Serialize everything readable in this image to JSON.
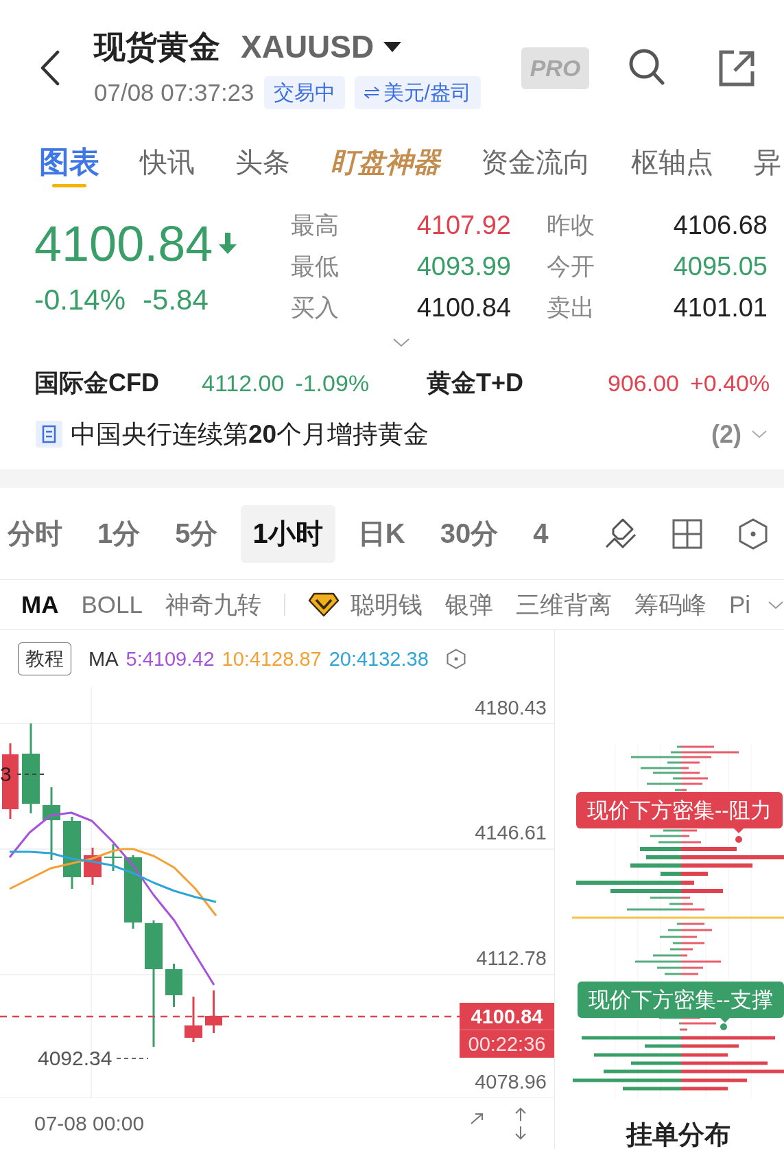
{
  "header": {
    "title": "现货黄金",
    "symbol": "XAUUSD",
    "time": "07/08 07:37:23",
    "badges": [
      {
        "kind": "status",
        "label": "交易中"
      },
      {
        "kind": "currency",
        "label": "美元/盎司"
      }
    ],
    "pro": "PRO"
  },
  "tabs": [
    {
      "label": "图表",
      "selected": true,
      "kind": "normal"
    },
    {
      "label": "快讯",
      "selected": false,
      "kind": "normal"
    },
    {
      "label": "头条",
      "selected": false,
      "kind": "normal"
    },
    {
      "label": "盯盘神器",
      "selected": false,
      "kind": "promo"
    },
    {
      "label": "资金流向",
      "selected": false,
      "kind": "normal"
    },
    {
      "label": "枢轴点",
      "selected": false,
      "kind": "normal"
    },
    {
      "label": "异",
      "selected": false,
      "kind": "normal"
    }
  ],
  "quote": {
    "price": "4100.84",
    "falling": true,
    "change_percent": "-0.14%",
    "change": "-5.84",
    "stats": [
      {
        "label": "最高",
        "value": "4107.92",
        "color": "#e0424f"
      },
      {
        "label": "昨收",
        "value": "4106.68",
        "color": "#222222"
      },
      {
        "label": "最低",
        "value": "4093.99",
        "color": "#3a9e69"
      },
      {
        "label": "今开",
        "value": "4095.05",
        "color": "#3a9e69"
      },
      {
        "label": "买入",
        "value": "4100.84",
        "color": "#222222"
      },
      {
        "label": "卖出",
        "value": "4101.01",
        "color": "#222222"
      }
    ]
  },
  "related": [
    {
      "name": "国际金CFD",
      "price": "4112.00",
      "change": "-1.09%",
      "color": "#3a9e69"
    },
    {
      "name": "黄金T+D",
      "price": "906.00",
      "change": "+0.40%",
      "color": "#e0424f"
    }
  ],
  "news": {
    "headline": "中国央行连续第**20**个月增持黄金",
    "count": "(2)"
  },
  "timeframes": [
    {
      "label": "分时",
      "selected": false
    },
    {
      "label": "1分",
      "selected": false
    },
    {
      "label": "5分",
      "selected": false
    },
    {
      "label": "1小时",
      "selected": true
    },
    {
      "label": "日K",
      "selected": false
    },
    {
      "label": "30分",
      "selected": false
    },
    {
      "label": "4",
      "selected": false
    }
  ],
  "indicators": [
    {
      "label": "MA",
      "selected": true
    },
    {
      "label": "BOLL",
      "selected": false
    },
    {
      "label": "神奇九转",
      "selected": false
    }
  ],
  "extra_indicators": [
    {
      "label": "聪明钱",
      "selected": false,
      "premium": true
    },
    {
      "label": "银弹",
      "selected": false,
      "premium": false
    },
    {
      "label": "三维背离",
      "selected": false,
      "premium": false
    },
    {
      "label": "筹码峰",
      "selected": false,
      "premium": false
    },
    {
      "label": "Pi",
      "selected": false,
      "premium": false
    }
  ],
  "chart": {
    "tutorial": "教程",
    "ma_label": "MA",
    "ma_values": [
      {
        "label": "5:4109.42",
        "color": "#a653dc"
      },
      {
        "label": "10:4128.87",
        "color": "#f3a136"
      },
      {
        "label": "20:4132.38",
        "color": "#2ea5d8"
      }
    ],
    "y_labels": [
      "4180.43",
      "4146.61",
      "4112.78",
      "4078.96"
    ],
    "high_marker": "3",
    "low_marker": "4092.34",
    "current_price": "4100.84",
    "countdown": "00:22:36",
    "x_label": "07-08 00:00"
  },
  "order_book": {
    "tips": [
      {
        "kind": "resistance",
        "text": "现价下方密集--阻力"
      },
      {
        "kind": "support",
        "text": "现价下方密集--支撑"
      }
    ],
    "title": "挂单分布"
  }
}
